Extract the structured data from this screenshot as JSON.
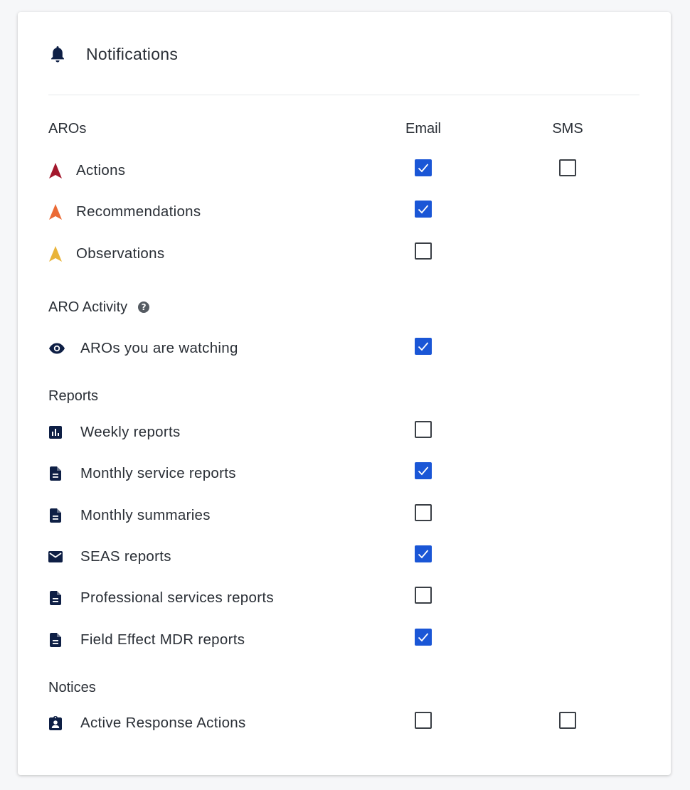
{
  "header": {
    "title": "Notifications",
    "icon": "bell-icon"
  },
  "columns": {
    "email": "Email",
    "sms": "SMS"
  },
  "colors": {
    "accent": "#1a56d6",
    "navy_icon": "#0e1f45",
    "actions_red": "#a3182d",
    "recommendations_orange": "#eb6a35",
    "observations_yellow": "#e9b43a"
  },
  "sections": {
    "aros": {
      "title": "AROs",
      "rows": [
        {
          "label": "Actions",
          "icon": "arrow-up-red-icon",
          "email": true,
          "sms": false
        },
        {
          "label": "Recommendations",
          "icon": "arrow-up-orange-icon",
          "email": true
        },
        {
          "label": "Observations",
          "icon": "arrow-up-yellow-icon",
          "email": false
        }
      ]
    },
    "aro_activity": {
      "title": "ARO Activity",
      "help_icon": "help-circle-icon",
      "rows": [
        {
          "label": "AROs you are watching",
          "icon": "eye-icon",
          "email": true
        }
      ]
    },
    "reports": {
      "title": "Reports",
      "rows": [
        {
          "label": "Weekly reports",
          "icon": "bar-chart-icon",
          "email": false
        },
        {
          "label": "Monthly service reports",
          "icon": "document-icon",
          "email": true
        },
        {
          "label": "Monthly summaries",
          "icon": "document-icon",
          "email": false
        },
        {
          "label": "SEAS reports",
          "icon": "envelope-icon",
          "email": true
        },
        {
          "label": "Professional services reports",
          "icon": "document-icon",
          "email": false
        },
        {
          "label": "Field Effect MDR reports",
          "icon": "document-icon",
          "email": true
        }
      ]
    },
    "notices": {
      "title": "Notices",
      "rows": [
        {
          "label": "Active Response Actions",
          "icon": "clipboard-user-icon",
          "email": false,
          "sms": false
        }
      ]
    }
  }
}
